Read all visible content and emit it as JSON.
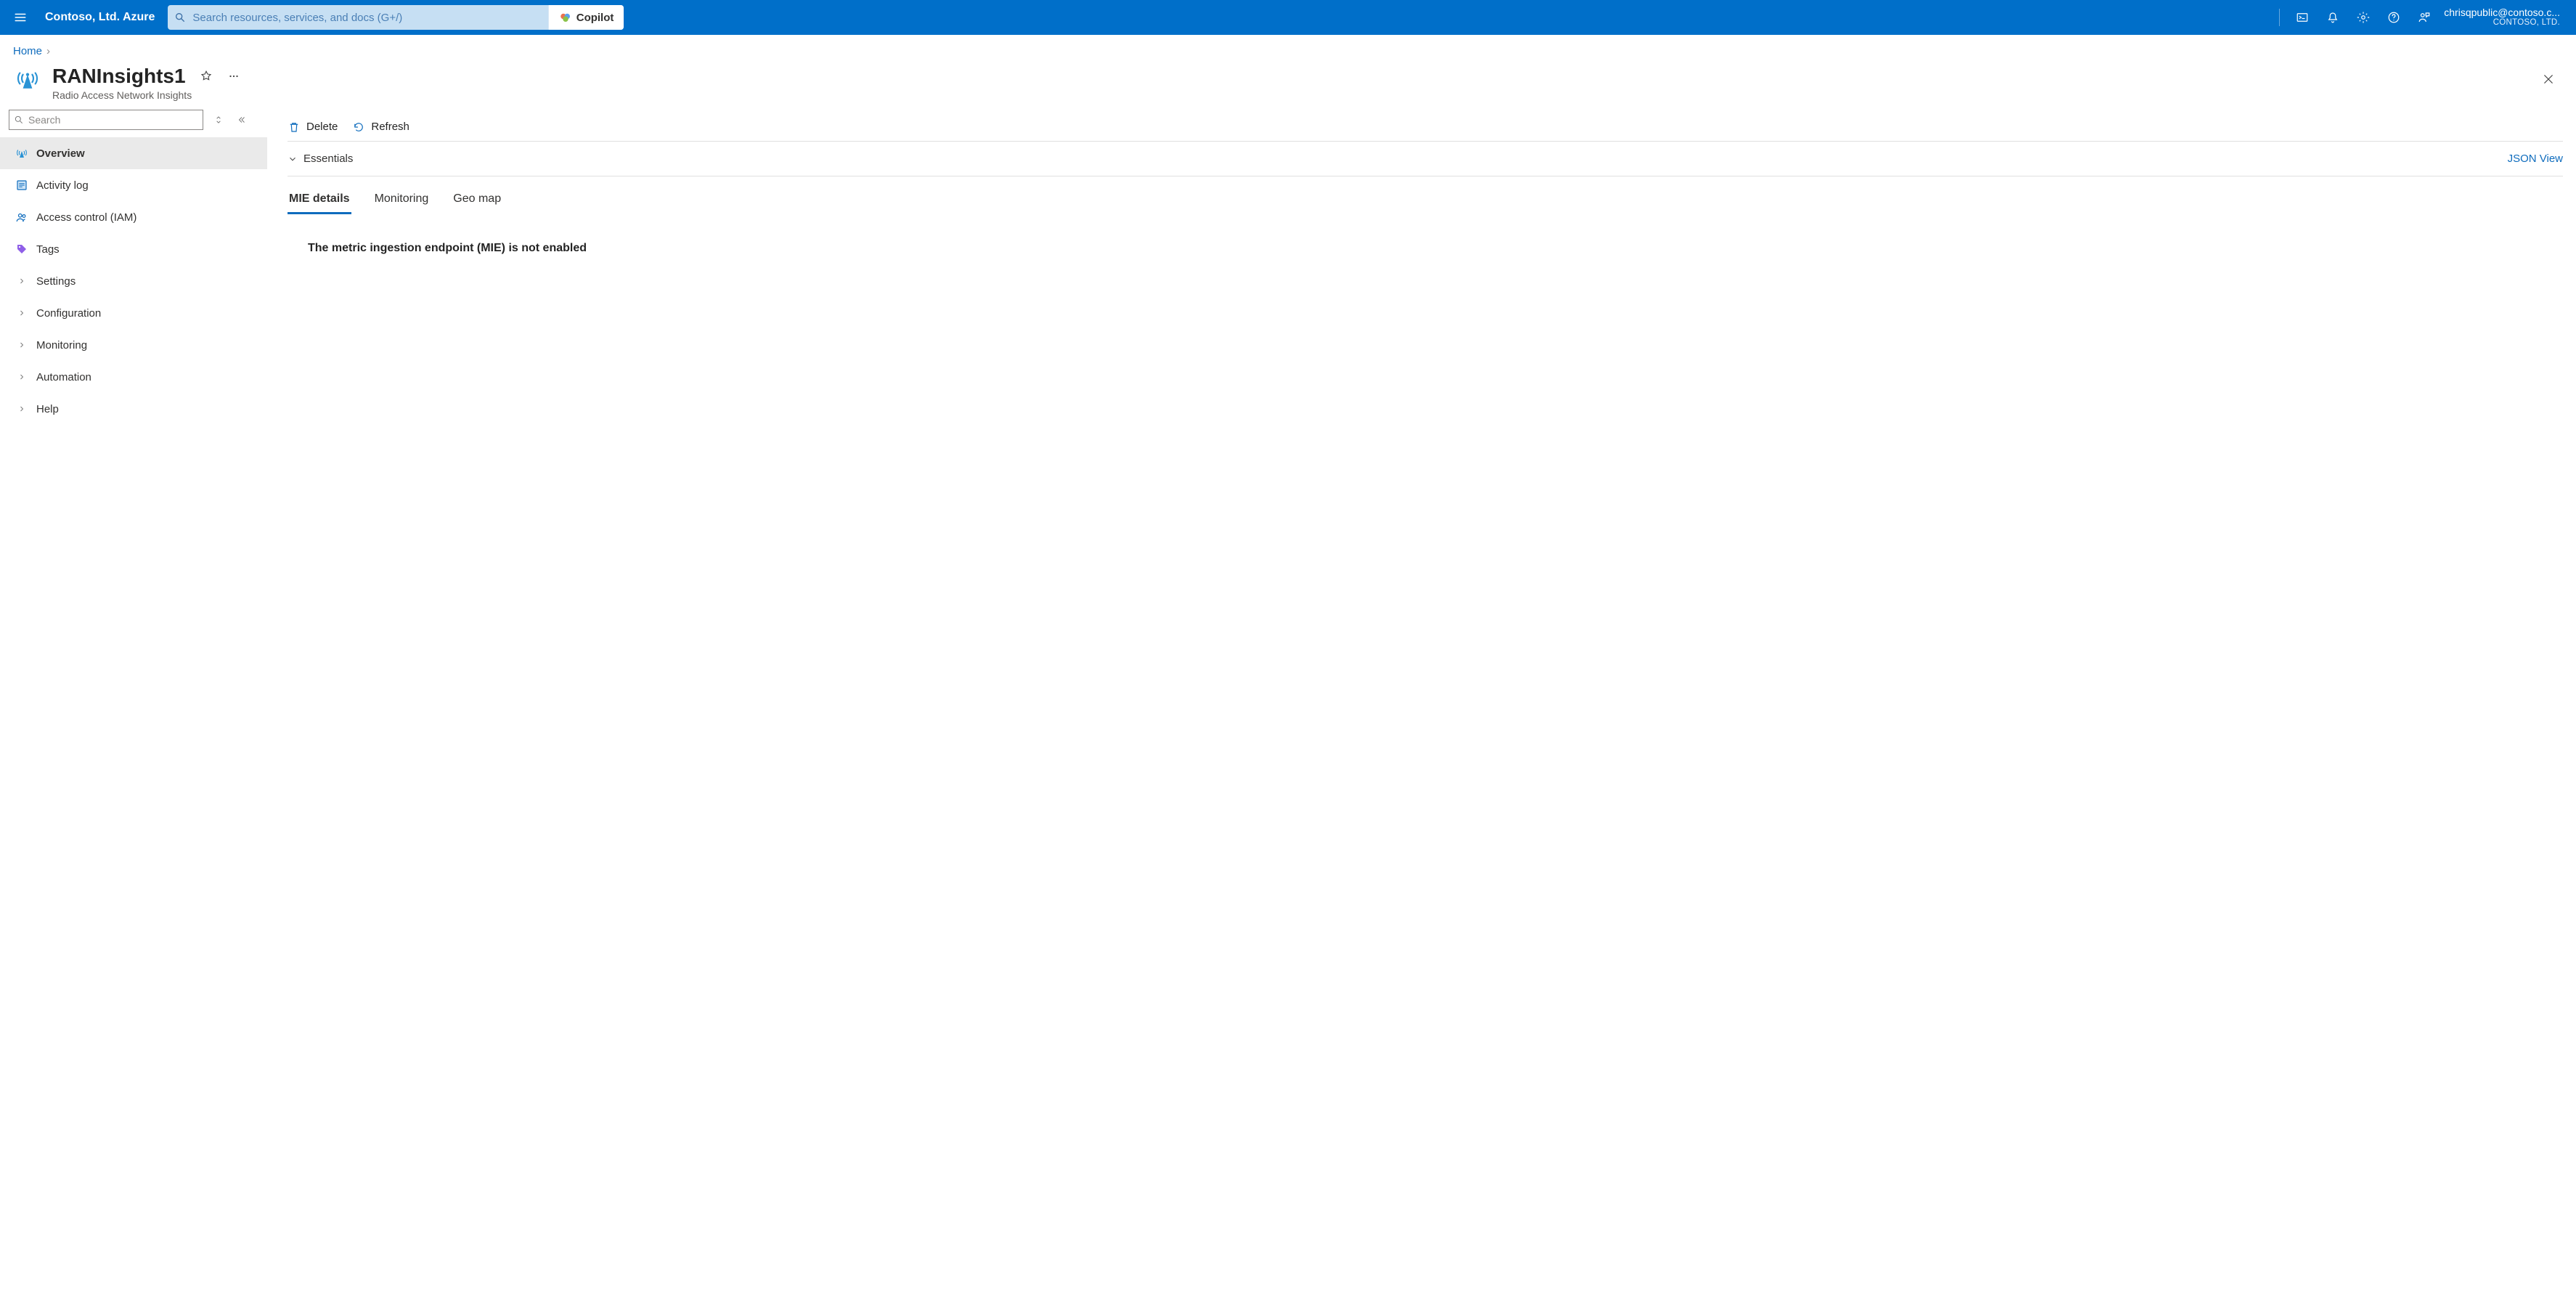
{
  "header": {
    "brand": "Contoso, Ltd. Azure",
    "search_placeholder": "Search resources, services, and docs (G+/)",
    "copilot_label": "Copilot",
    "account_email": "chrisqpublic@contoso.c...",
    "account_tenant": "CONTOSO, LTD."
  },
  "breadcrumb": {
    "home": "Home"
  },
  "resource": {
    "title": "RANInsights1",
    "subtype": "Radio Access Network Insights"
  },
  "sidebar": {
    "search_placeholder": "Search",
    "items": [
      {
        "label": "Overview",
        "icon": "antenna",
        "selected": true
      },
      {
        "label": "Activity log",
        "icon": "activity",
        "selected": false
      },
      {
        "label": "Access control (IAM)",
        "icon": "people",
        "selected": false
      },
      {
        "label": "Tags",
        "icon": "tag",
        "selected": false
      },
      {
        "label": "Settings",
        "icon": "chevron",
        "selected": false
      },
      {
        "label": "Configuration",
        "icon": "chevron",
        "selected": false
      },
      {
        "label": "Monitoring",
        "icon": "chevron",
        "selected": false
      },
      {
        "label": "Automation",
        "icon": "chevron",
        "selected": false
      },
      {
        "label": "Help",
        "icon": "chevron",
        "selected": false
      }
    ]
  },
  "commands": {
    "delete": "Delete",
    "refresh": "Refresh"
  },
  "essentials": {
    "label": "Essentials",
    "json_view": "JSON View"
  },
  "tabs": [
    {
      "label": "MIE details",
      "active": true
    },
    {
      "label": "Monitoring",
      "active": false
    },
    {
      "label": "Geo map",
      "active": false
    }
  ],
  "content": {
    "message": "The metric ingestion endpoint (MIE) is not enabled"
  }
}
